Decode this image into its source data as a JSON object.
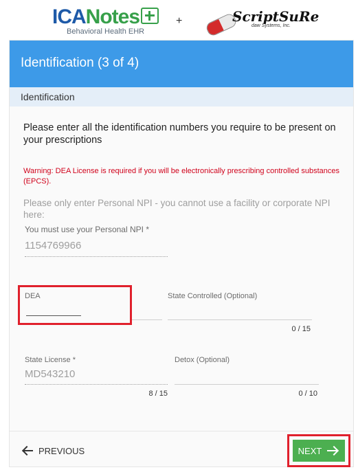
{
  "logos": {
    "icanotes": {
      "ica": "ICA",
      "notes": "Notes",
      "subtitle": "Behavioral Health EHR"
    },
    "separator": "+",
    "scriptsure": {
      "name": "ScriptSuRe",
      "subtitle": "daw Systems, Inc."
    }
  },
  "header": {
    "title": "Identification (3 of 4)"
  },
  "section": {
    "title": "Identification"
  },
  "instructions": "Please enter all the identification numbers you require to be present on your prescriptions",
  "warning": "Warning: DEA License is required if you will be electronically prescribing controlled substances (EPCS).",
  "npi_note": "Please only enter Personal NPI - you cannot use a facility or corporate NPI here:",
  "fields": {
    "npi": {
      "label": "You must use your Personal NPI *",
      "value": "1154769966"
    },
    "dea": {
      "label": "DEA",
      "value": ""
    },
    "state_controlled": {
      "label": "State Controlled (Optional)",
      "value": "",
      "counter": "0 / 15"
    },
    "state_license": {
      "label": "State License *",
      "value": "MD543210",
      "counter": "8 / 15"
    },
    "detox": {
      "label": "Detox (Optional)",
      "value": "",
      "counter": "0 / 10"
    }
  },
  "footer": {
    "previous_label": "PREVIOUS",
    "next_label": "NEXT"
  },
  "colors": {
    "header_bg": "#3d9ae8",
    "section_bg": "#e4eef8",
    "warning": "#d0021b",
    "next_button": "#4caf50",
    "highlight_box": "#e0202c"
  },
  "icons": {
    "previous": "arrow-left-icon",
    "next": "arrow-right-icon"
  }
}
